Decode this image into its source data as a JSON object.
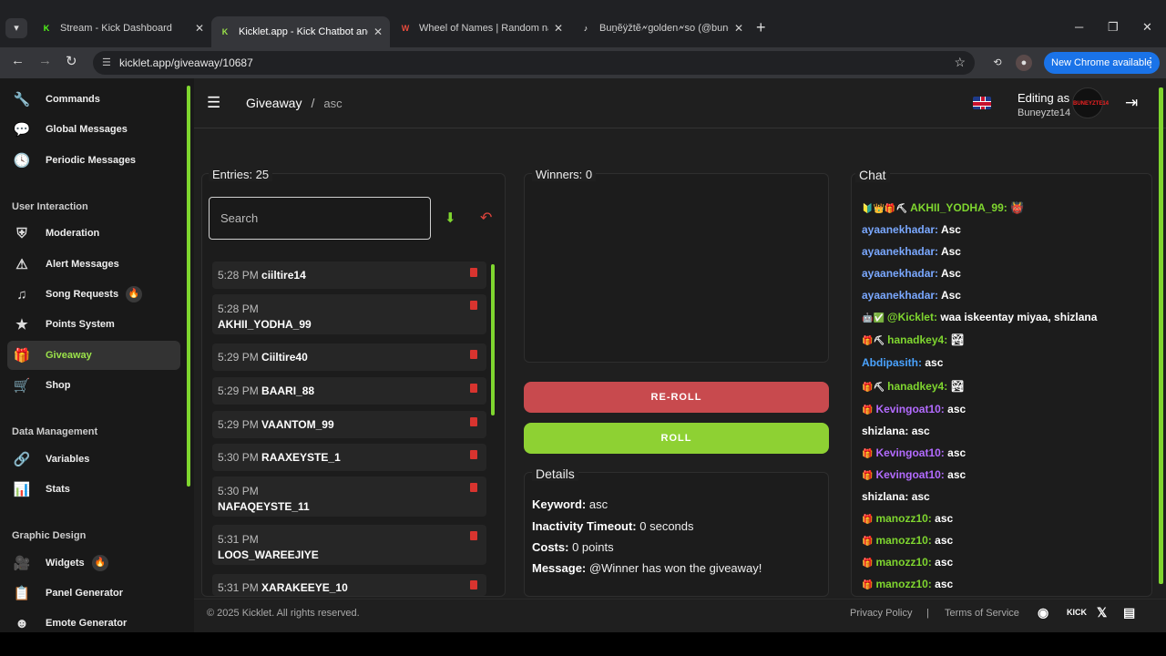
{
  "browser": {
    "tabs": [
      {
        "title": "Stream - Kick Dashboard",
        "favicon": "K",
        "favicon_color": "#53fc18"
      },
      {
        "title": "Kicklet.app - Kick Chatbot and C",
        "favicon": "K",
        "favicon_color": "#9be34a"
      },
      {
        "title": "Wheel of Names | Random nam",
        "favicon": "W",
        "favicon_color": "#e94b3c"
      },
      {
        "title": "Buṉẽÿžtẽ🗲golden🗲so (@buneyz",
        "favicon": "♪",
        "favicon_color": "#ffffff"
      }
    ],
    "url": "kicklet.app/giveaway/10687",
    "new_chrome_label": "New Chrome available"
  },
  "sidebar": {
    "items_top": [
      {
        "label": "Commands",
        "icon": "wrench-icon"
      },
      {
        "label": "Global Messages",
        "icon": "chat-bubble-icon"
      },
      {
        "label": "Periodic Messages",
        "icon": "clock-icon"
      }
    ],
    "section_user": "User Interaction",
    "items_user": [
      {
        "label": "Moderation",
        "icon": "shield-icon"
      },
      {
        "label": "Alert Messages",
        "icon": "warning-icon"
      },
      {
        "label": "Song Requests",
        "icon": "music-note-icon",
        "badge": "🔥"
      },
      {
        "label": "Points System",
        "icon": "star-icon"
      },
      {
        "label": "Giveaway",
        "icon": "gift-icon",
        "active": true
      },
      {
        "label": "Shop",
        "icon": "cart-icon"
      }
    ],
    "section_data": "Data Management",
    "items_data": [
      {
        "label": "Variables",
        "icon": "link-icon"
      },
      {
        "label": "Stats",
        "icon": "bar-chart-icon"
      }
    ],
    "section_graphic": "Graphic Design",
    "items_graphic": [
      {
        "label": "Widgets",
        "icon": "video-icon",
        "badge": "🔥"
      },
      {
        "label": "Panel Generator",
        "icon": "clipboard-icon"
      },
      {
        "label": "Emote Generator",
        "icon": "smiley-icon"
      }
    ]
  },
  "header": {
    "title": "Giveaway",
    "subtitle": "asc",
    "editing_label": "Editing as",
    "editing_user": "Buneyzte14",
    "avatar_text": "BUNEYZTE14"
  },
  "entries": {
    "title": "Entries: 25",
    "search_placeholder": "Search",
    "list": [
      {
        "time": "5:28 PM",
        "name": "ciiltire14"
      },
      {
        "time": "5:28 PM",
        "name": "AKHII_YODHA_99",
        "wrap": true
      },
      {
        "time": "5:29 PM",
        "name": "Ciiltire40"
      },
      {
        "time": "5:29 PM",
        "name": "BAARI_88"
      },
      {
        "time": "5:29 PM",
        "name": "VAANTOM_99"
      },
      {
        "time": "5:30 PM",
        "name": "RAAXEYSTE_1"
      },
      {
        "time": "5:30 PM",
        "name": "NAFAQEYSTE_11",
        "wrap": true
      },
      {
        "time": "5:31 PM",
        "name": "LOOS_WAREEJIYE",
        "wrap": true
      },
      {
        "time": "5:31 PM",
        "name": "XARAKEEYE_10"
      }
    ]
  },
  "winners": {
    "title": "Winners: 0",
    "reroll_label": "RE-ROLL",
    "roll_label": "ROLL"
  },
  "details": {
    "title": "Details",
    "keyword_label": "Keyword:",
    "keyword": "asc",
    "timeout_label": "Inactivity Timeout:",
    "timeout": "0 seconds",
    "costs_label": "Costs:",
    "costs": "0 points",
    "message_label": "Message:",
    "message": "@Winner has won the giveaway!"
  },
  "chat": {
    "title": "Chat",
    "messages": [
      {
        "badges": "🔰👑🎁⛏",
        "user": "AKHII_YODHA_99:",
        "color": "#7fd62f",
        "text": "👹"
      },
      {
        "badges": "",
        "user": "ayaanekhadar:",
        "color": "#7aa8ff",
        "text": "Asc"
      },
      {
        "badges": "",
        "user": "ayaanekhadar:",
        "color": "#7aa8ff",
        "text": "Asc"
      },
      {
        "badges": "",
        "user": "ayaanekhadar:",
        "color": "#7aa8ff",
        "text": "Asc"
      },
      {
        "badges": "",
        "user": "ayaanekhadar:",
        "color": "#7aa8ff",
        "text": "Asc"
      },
      {
        "badges": "🤖✅",
        "user": "@Kicklet:",
        "color": "#7fd62f",
        "text": "waa iskeentay miyaa, shizlana"
      },
      {
        "badges": "🎁⛏",
        "user": "hanadkey4:",
        "color": "#7fd62f",
        "text": "🏞"
      },
      {
        "badges": "",
        "user": "Abdipasith:",
        "color": "#4aa3ff",
        "text": "asc"
      },
      {
        "badges": "🎁⛏",
        "user": "hanadkey4:",
        "color": "#7fd62f",
        "text": "🏞"
      },
      {
        "badges": "🎁",
        "user": "Kevingoat10:",
        "color": "#b36bff",
        "text": "asc"
      },
      {
        "badges": "",
        "user": "shizlana:",
        "color": "#ffffff",
        "text": "asc"
      },
      {
        "badges": "🎁",
        "user": "Kevingoat10:",
        "color": "#b36bff",
        "text": "asc"
      },
      {
        "badges": "🎁",
        "user": "Kevingoat10:",
        "color": "#b36bff",
        "text": "asc"
      },
      {
        "badges": "",
        "user": "shizlana:",
        "color": "#ffffff",
        "text": "asc"
      },
      {
        "badges": "🎁",
        "user": "manozz10:",
        "color": "#7fd62f",
        "text": "asc"
      },
      {
        "badges": "🎁",
        "user": "manozz10:",
        "color": "#7fd62f",
        "text": "asc"
      },
      {
        "badges": "🎁",
        "user": "manozz10:",
        "color": "#7fd62f",
        "text": "asc"
      },
      {
        "badges": "🎁",
        "user": "manozz10:",
        "color": "#7fd62f",
        "text": "asc"
      }
    ]
  },
  "footer": {
    "copyright": "© 2025 Kicklet. All rights reserved.",
    "privacy": "Privacy Policy",
    "separator": "|",
    "terms": "Terms of Service",
    "kick_label": "KICK"
  }
}
